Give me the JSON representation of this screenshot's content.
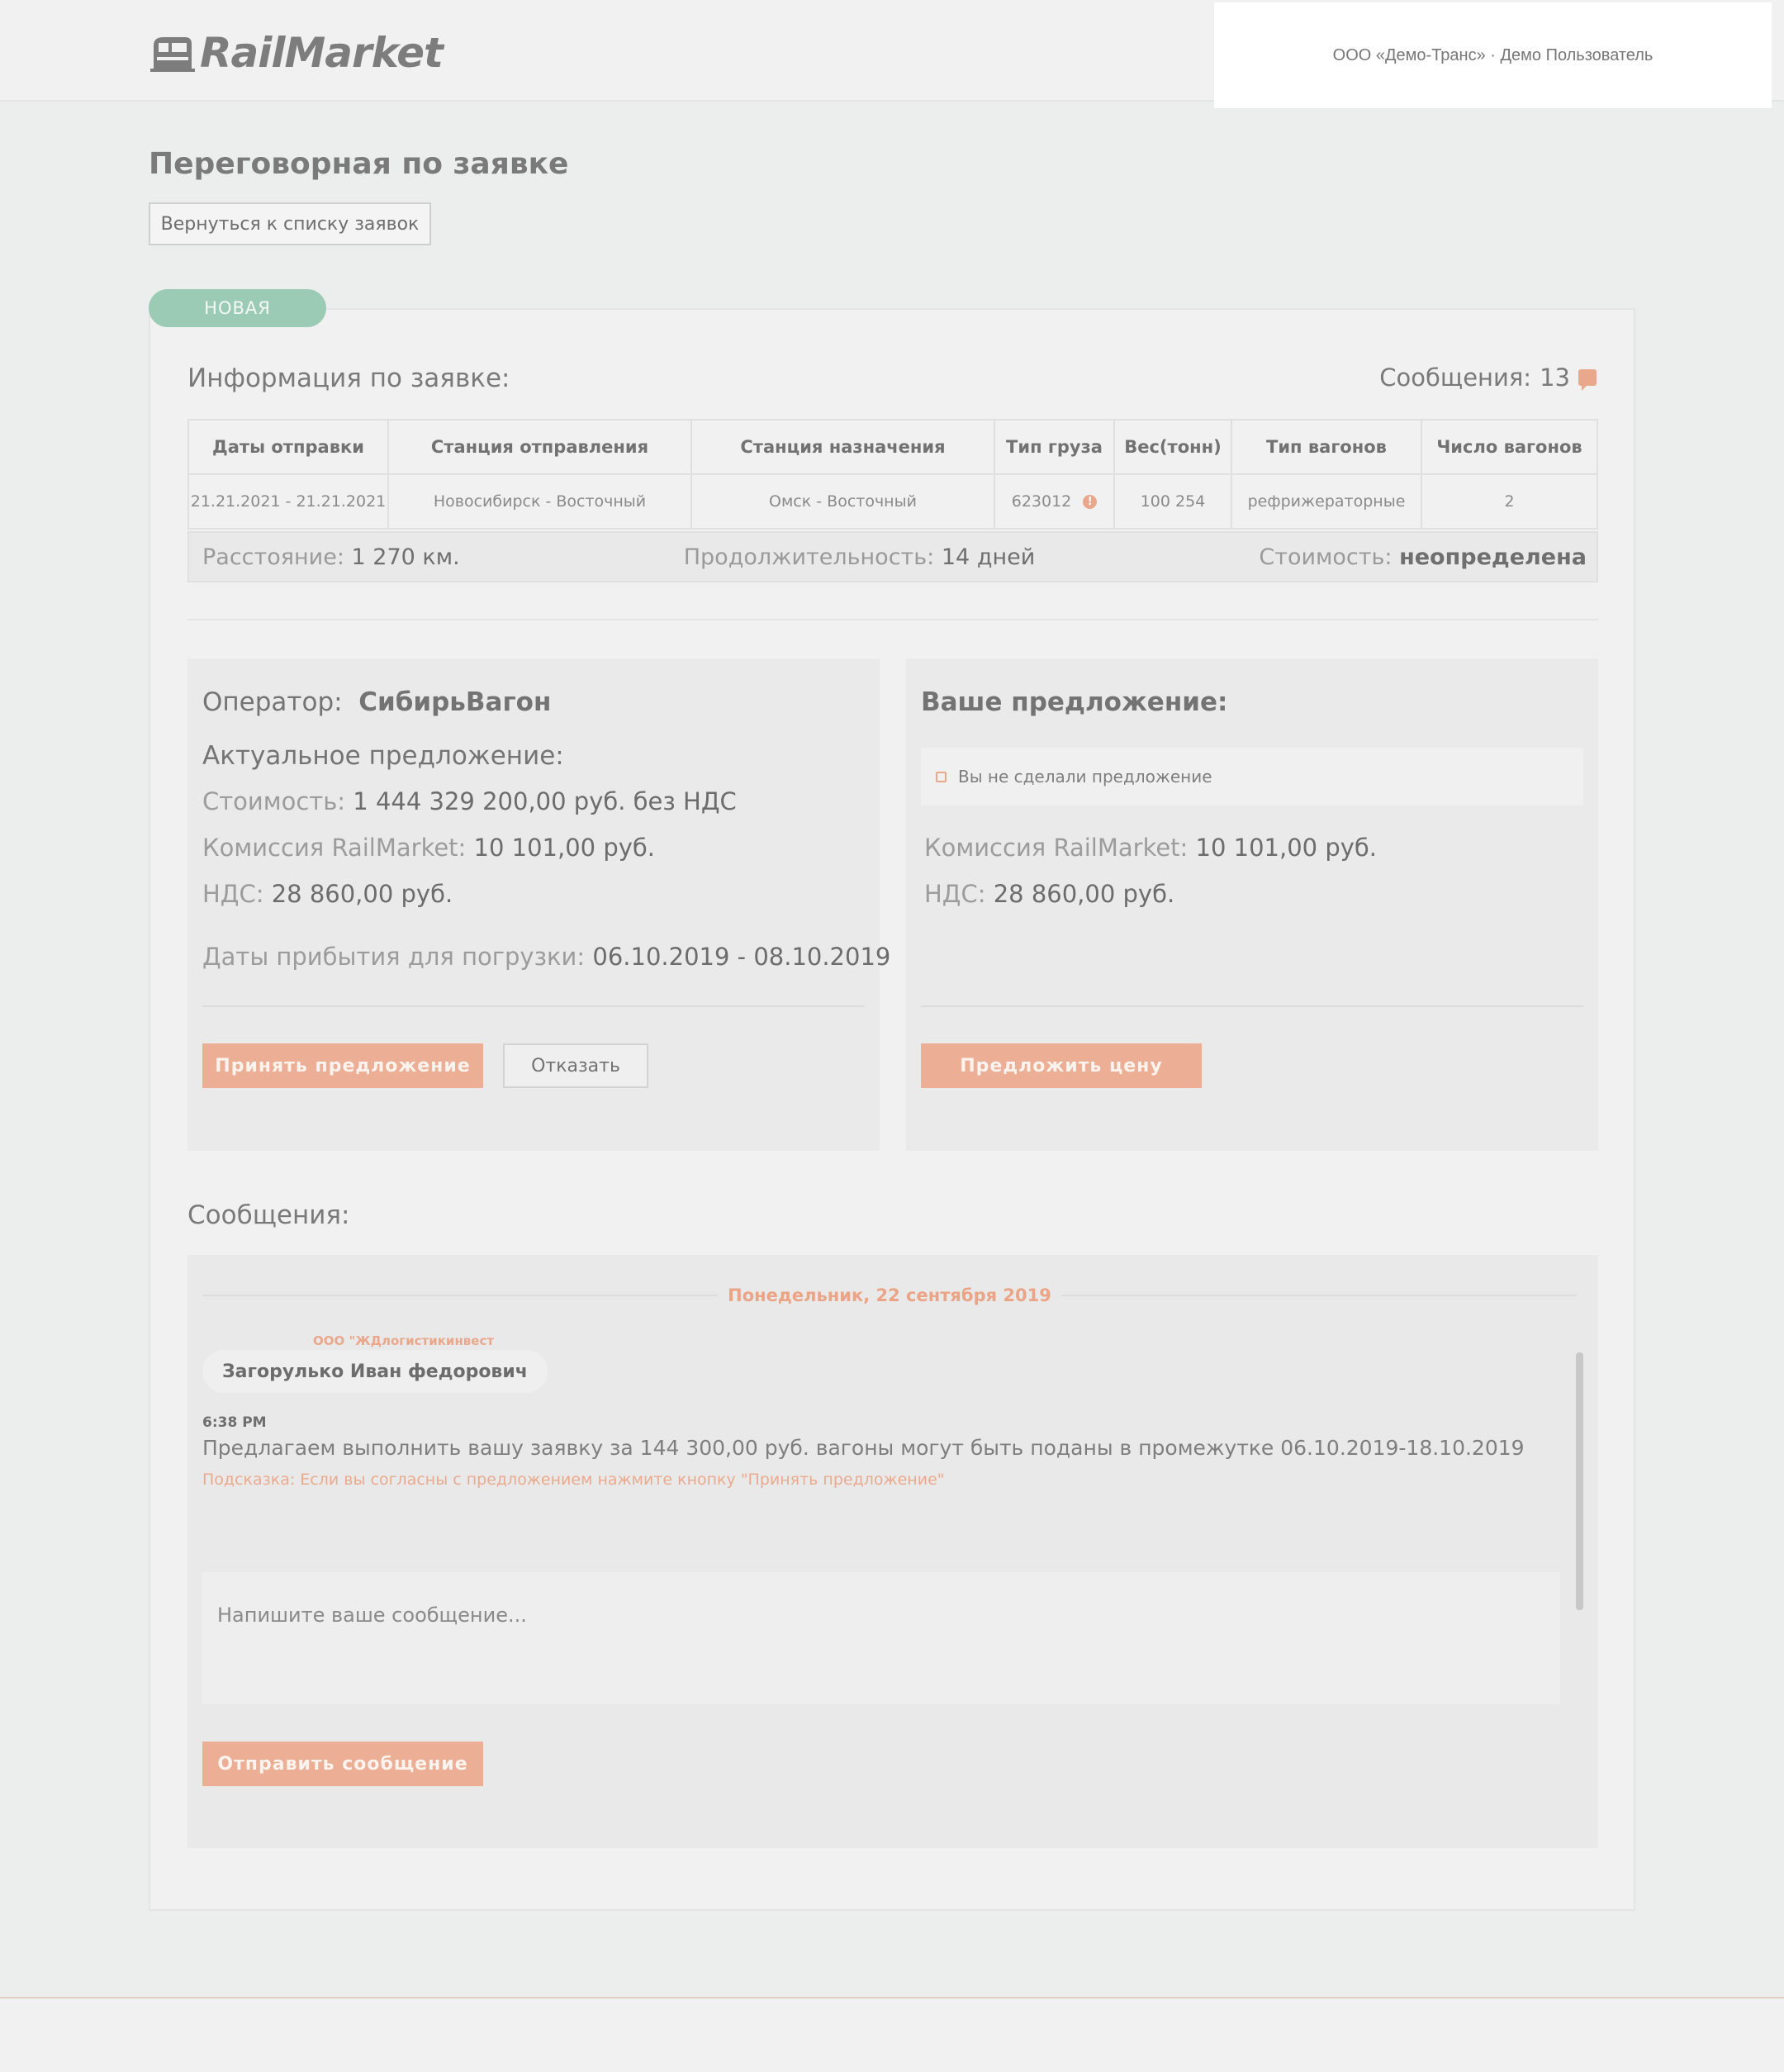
{
  "header": {
    "logo_text": "RailMarket",
    "user_info": "ООО «Демо-Транс» · Демо Пользователь"
  },
  "page": {
    "title": "Переговорная по заявке",
    "back_label": "Вернуться к списку заявок"
  },
  "request": {
    "status": "НОВАЯ",
    "info_title": "Информация по заявке:",
    "messages_label": "Сообщения:",
    "messages_count": "13",
    "columns": [
      "Даты отправки",
      "Станция отправления",
      "Станция назначения",
      "Тип груза",
      "Вес(тонн)",
      "Тип вагонов",
      "Число вагонов"
    ],
    "row": [
      "21.21.2021 - 21.21.2021",
      "Новосибирск - Восточный",
      "Омск - Восточный",
      "623012",
      "100 254",
      "рефрижераторные",
      "2"
    ],
    "distance_label": "Расстояние:",
    "distance_value": "1 270 км.",
    "duration_label": "Продолжительность:",
    "duration_value": "14 дней",
    "cost_label": "Стоимость:",
    "cost_value": "неопределена"
  },
  "operator_panel": {
    "operator_label": "Оператор:",
    "operator_name": "СибирьВагон",
    "current_offer": "Актуальное предложение:",
    "cost_label": "Стоимость:",
    "cost_value": "1 444 329 200,00 руб. без НДС",
    "commission_label": "Комиссия RailMarket:",
    "commission_value": "10 101,00 руб.",
    "vat_label": "НДС:",
    "vat_value": "28 860,00 руб.",
    "arrival_label": "Даты прибытия для погрузки:",
    "arrival_value": "06.10.2019 - 08.10.2019",
    "accept_label": "Принять предложение",
    "decline_label": "Отказать"
  },
  "your_offer_panel": {
    "title": "Ваше предложение:",
    "no_offer": "Вы не сделали предложение",
    "commission_label": "Комиссия RailMarket:",
    "commission_value": "10 101,00 руб.",
    "vat_label": "НДС:",
    "vat_value": "28 860,00 руб.",
    "propose_label": "Предложить цену"
  },
  "messages": {
    "title": "Сообщения:",
    "date": "Понедельник, 22 сентября 2019",
    "company": "ООО \"ЖДлогистикинвест",
    "author": "Загорулько Иван федорович",
    "time": "6:38 PM",
    "text": "Предлагаем выполнить вашу заявку за 144 300,00 руб. вагоны могут быть поданы в промежутке 06.10.2019-18.10.2019",
    "hint": "Подсказка: Если вы согласны с предложением нажмите кнопку \"Принять предложение\"",
    "input_placeholder": "Напишите ваше сообщение...",
    "send_label": "Отправить сообщение"
  },
  "colors": {
    "accent": "#ecae94",
    "status_green": "#9ccbb5",
    "background": "#eceded"
  }
}
